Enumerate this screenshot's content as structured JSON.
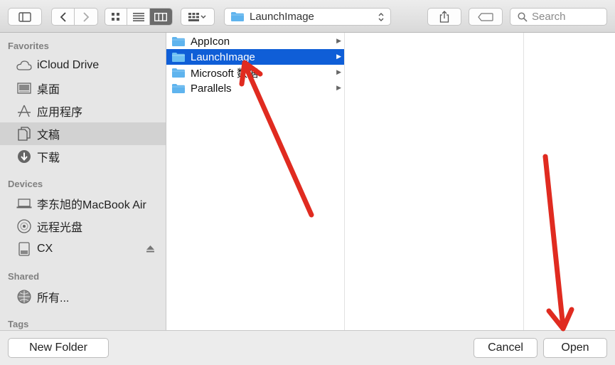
{
  "toolbar": {
    "path_label": "LaunchImage",
    "search_placeholder": "Search"
  },
  "sidebar": {
    "favorites_header": "Favorites",
    "favorites": [
      {
        "label": "iCloud Drive",
        "icon": "cloud-icon"
      },
      {
        "label": "桌面",
        "icon": "desktop-icon"
      },
      {
        "label": "应用程序",
        "icon": "applications-icon"
      },
      {
        "label": "文稿",
        "icon": "documents-icon",
        "selected": true
      },
      {
        "label": "下载",
        "icon": "downloads-icon"
      }
    ],
    "devices_header": "Devices",
    "devices": [
      {
        "label": "李东旭的MacBook Air",
        "icon": "laptop-icon"
      },
      {
        "label": "远程光盘",
        "icon": "disc-icon"
      },
      {
        "label": "CX",
        "icon": "drive-icon"
      }
    ],
    "shared_header": "Shared",
    "shared": [
      {
        "label": "所有...",
        "icon": "network-icon"
      }
    ],
    "tags_header": "Tags"
  },
  "column1": {
    "items": [
      {
        "label": "AppIcon"
      },
      {
        "label": "LaunchImage",
        "selected": true
      },
      {
        "label": "Microsoft 数据"
      },
      {
        "label": "Parallels"
      }
    ]
  },
  "bottom": {
    "new_folder": "New Folder",
    "cancel": "Cancel",
    "open": "Open"
  },
  "colors": {
    "selection": "#0f5ed7",
    "folder": "#5fb4ee",
    "annotation_arrow": "#e02b20"
  }
}
